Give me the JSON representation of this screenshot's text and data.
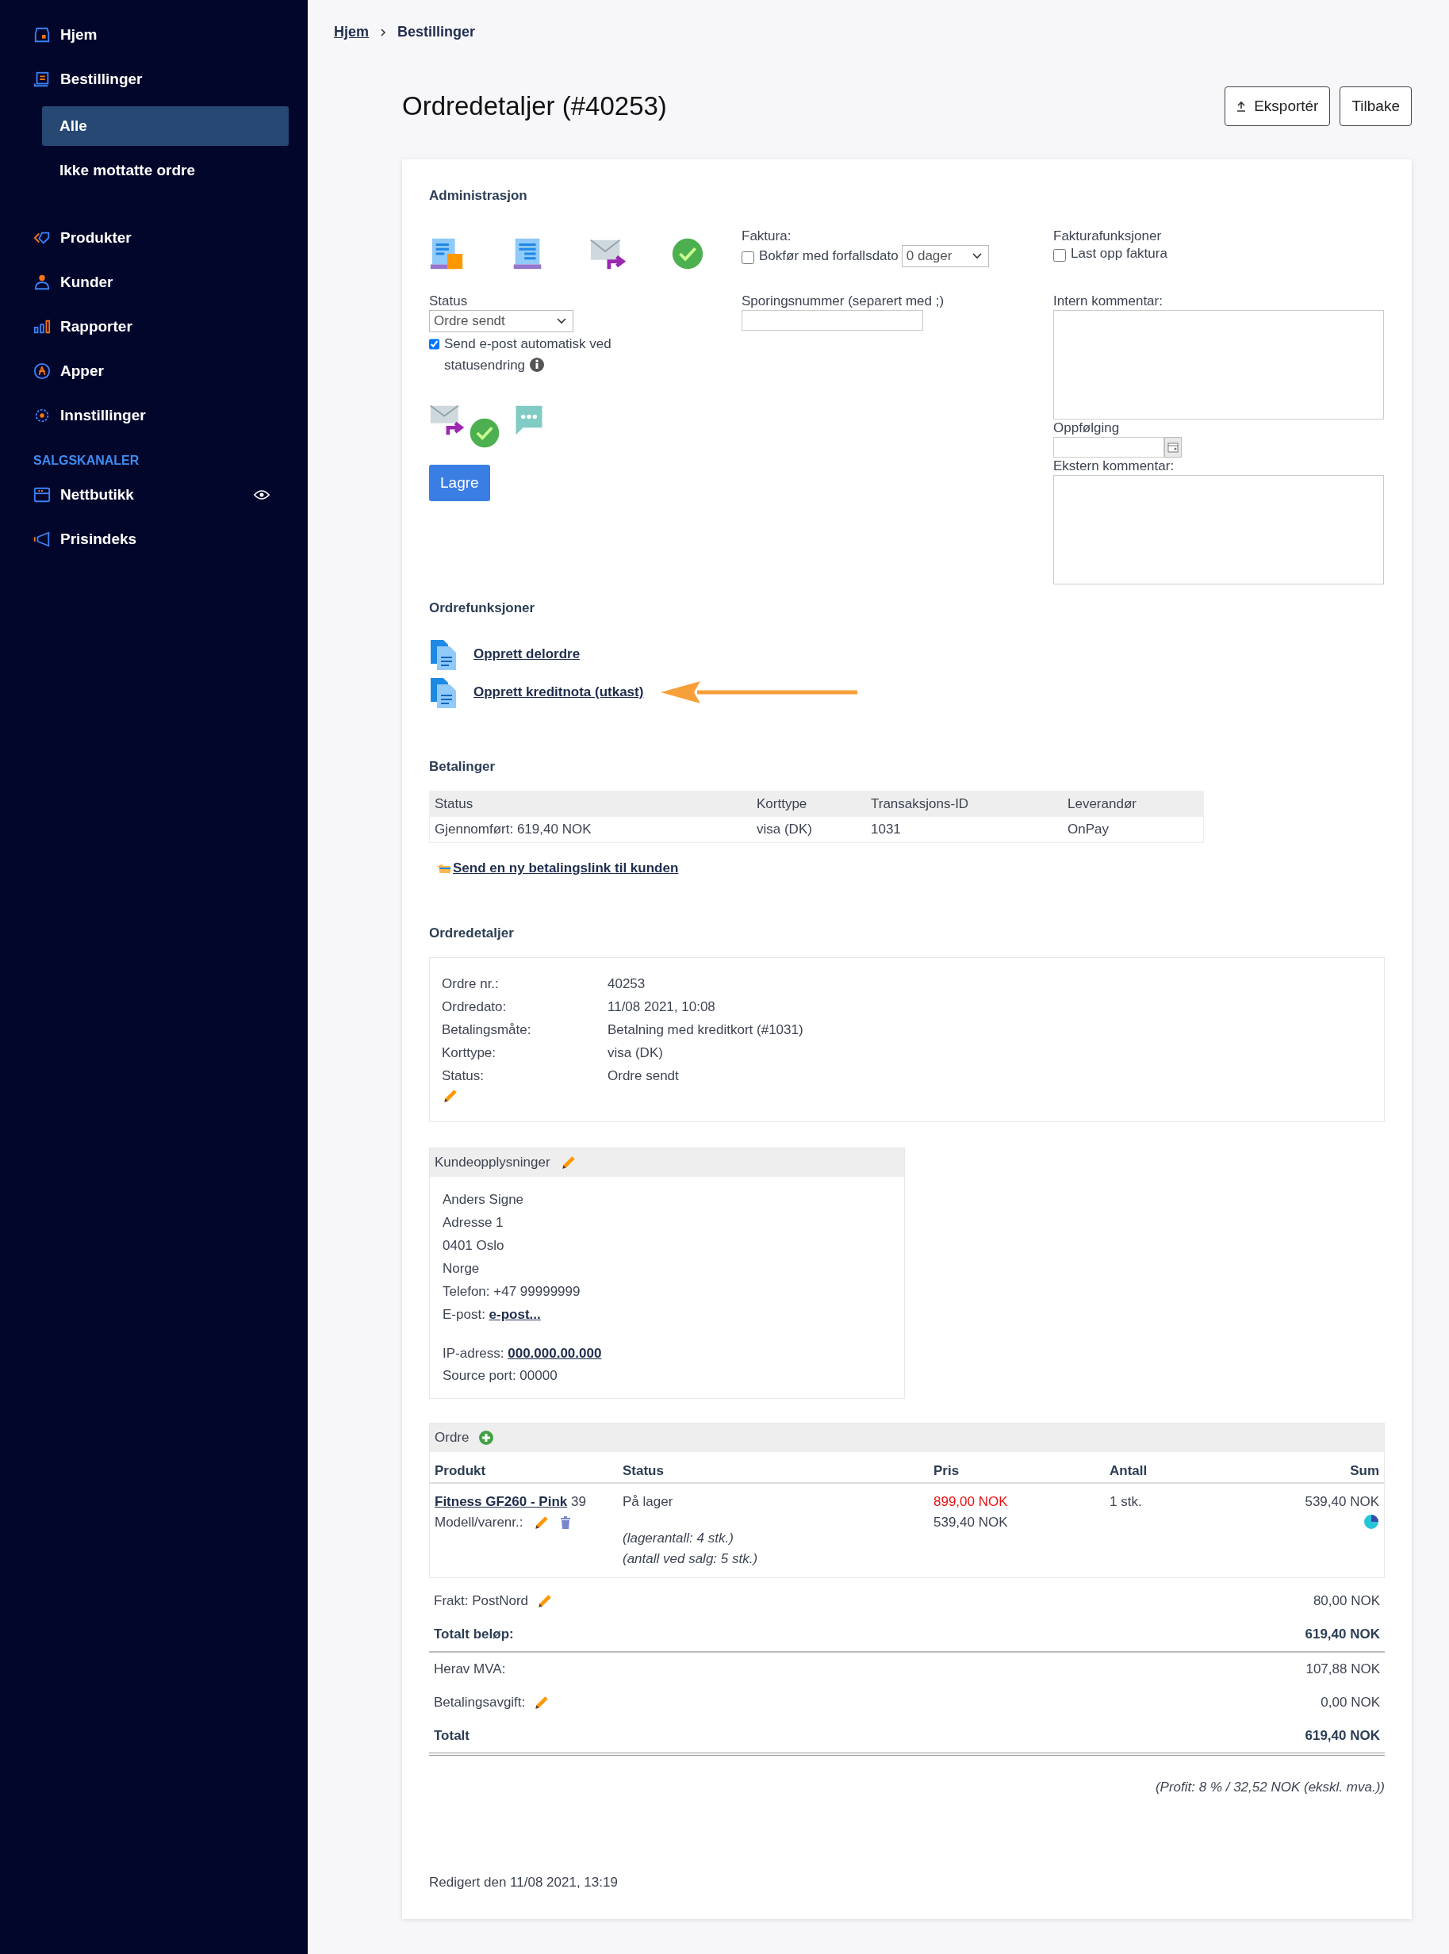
{
  "sidebar": {
    "items": [
      {
        "label": "Hjem",
        "kind": "home"
      },
      {
        "label": "Bestillinger",
        "kind": "orders",
        "children": [
          {
            "label": "Alle",
            "selected": true
          },
          {
            "label": "Ikke mottatte ordre",
            "selected": false
          }
        ]
      },
      {
        "label": "Produkter",
        "kind": "tag"
      },
      {
        "label": "Kunder",
        "kind": "person"
      },
      {
        "label": "Rapporter",
        "kind": "bars"
      },
      {
        "label": "Apper",
        "kind": "apps"
      },
      {
        "label": "Innstillinger",
        "kind": "gear"
      }
    ],
    "section_label": "SALGSKANALER",
    "channels": [
      {
        "label": "Nettbutikk",
        "kind": "store",
        "visible": true
      },
      {
        "label": "Prisindeks",
        "kind": "megaphone",
        "visible": false
      }
    ]
  },
  "breadcrumb": [
    {
      "label": "Hjem",
      "link": true
    },
    {
      "label": "Bestillinger",
      "link": false
    }
  ],
  "header": {
    "title": "Ordredetaljer (#40253)",
    "buttons": [
      {
        "label": "Eksportér",
        "kind": "export"
      },
      {
        "label": "Tilbake",
        "kind": "plain"
      }
    ]
  },
  "admin": {
    "heading": "Administrasjon",
    "invoice": {
      "label": "Faktura:",
      "checkbox_label": "Bokfør med forfallsdato",
      "checked": false,
      "select_value": "0 dager"
    },
    "invoice_functions": {
      "label": "Fakturafunksjoner",
      "checkbox_label": "Last opp faktura",
      "checked": false
    },
    "status": {
      "label": "Status",
      "value": "Ordre sendt",
      "auto_email_label": "Send e-post automatisk ved statusendring",
      "auto_email_checked": true
    },
    "tracking_label": "Sporingsnummer (separert med ;)",
    "internal_comment_label": "Intern kommentar:",
    "followup_label": "Oppfølging",
    "external_comment_label": "Ekstern kommentar:",
    "save_button": "Lagre"
  },
  "order_functions": {
    "heading": "Ordrefunksjoner",
    "links": [
      {
        "label": "Opprett delordre",
        "highlighted": false
      },
      {
        "label": "Opprett kreditnota (utkast)",
        "highlighted": true
      }
    ]
  },
  "payments": {
    "heading": "Betalinger",
    "columns": [
      "Status",
      "Korttype",
      "Transaksjons-ID",
      "Leverandør"
    ],
    "rows": [
      [
        "Gjennomført: 619,40 NOK",
        "visa (DK)",
        "1031",
        "OnPay"
      ]
    ],
    "link": "Send en ny betalingslink til kunden"
  },
  "order_details": {
    "heading": "Ordredetaljer",
    "fields": [
      {
        "label": "Ordre nr.:",
        "value": "40253"
      },
      {
        "label": "Ordredato:",
        "value": "11/08 2021, 10:08"
      },
      {
        "label": "Betalingsmåte:",
        "value": "Betalning med kreditkort (#1031)"
      },
      {
        "label": "Korttype:",
        "value": "visa (DK)"
      },
      {
        "label": "Status:",
        "value": "Ordre sendt"
      }
    ]
  },
  "customer": {
    "heading": "Kundeopplysninger",
    "lines": [
      "Anders Signe",
      "Adresse 1",
      "0401 Oslo",
      "Norge",
      "Telefon: +47 99999999"
    ],
    "email_label": "E-post:",
    "email_link": "e-post...",
    "ip_label": "IP-adress:",
    "ip_link": "000.000.00.000",
    "source_port": "Source port: 00000"
  },
  "order": {
    "heading": "Ordre",
    "columns": [
      "Produkt",
      "Status",
      "Pris",
      "Antall",
      "Sum"
    ],
    "items": [
      {
        "product": "Fitness GF260 - Pink",
        "number": "39",
        "model_label": "Modell/varenr.:",
        "status": "På lager",
        "notes": [
          "(lagerantall: 4 stk.)",
          "(antall ved salg: 5 stk.)"
        ],
        "original_price": "899,00 NOK",
        "price": "539,40 NOK",
        "quantity": "1 stk.",
        "sum": "539,40 NOK"
      }
    ],
    "summary": [
      {
        "label": "Frakt: PostNord",
        "value": "80,00 NOK",
        "kind": "line",
        "editable": true
      },
      {
        "label": "Totalt beløp:",
        "value": "619,40 NOK",
        "kind": "subtotal",
        "editable": false
      },
      {
        "label": "Herav MVA:",
        "value": "107,88 NOK",
        "kind": "line",
        "editable": false
      },
      {
        "label": "Betalingsavgift:",
        "value": "0,00 NOK",
        "kind": "line",
        "editable": true
      },
      {
        "label": "Totalt",
        "value": "619,40 NOK",
        "kind": "total",
        "editable": false
      }
    ],
    "profit": "(Profit: 8 % / 32,52 NOK (ekskl. mva.))"
  },
  "edited": "Redigert den 11/08 2021, 13:19"
}
